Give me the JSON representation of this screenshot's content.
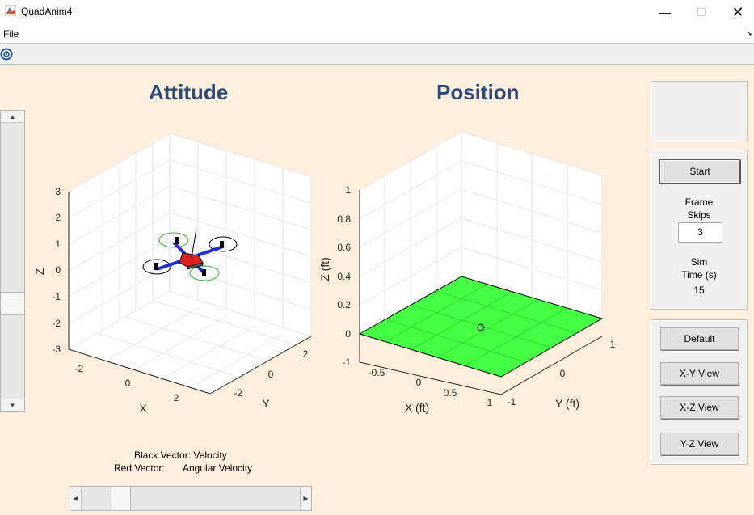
{
  "window": {
    "title": "QuadAnim4",
    "minimize_glyph": "—",
    "maximize_glyph": "☐",
    "close_glyph": "✕"
  },
  "menu": {
    "file_label": "File"
  },
  "toolbar": {
    "icon": "restore-view-icon"
  },
  "colors": {
    "figure_background": "#fdefdc",
    "title_color": "#2e4a7a",
    "ground_plane": "#44ff44",
    "arm_color": "#1f2fd8",
    "body_color": "#dd2020",
    "rotor_green": "#22bb22"
  },
  "attitude_plot": {
    "title": "Attitude",
    "xlabel": "X",
    "ylabel": "Y",
    "zlabel": "Z",
    "z_ticks": [
      "3",
      "2",
      "1",
      "0",
      "-1",
      "-2",
      "-3"
    ],
    "x_ticks": [
      "-2",
      "0",
      "2"
    ],
    "y_ticks": [
      "2",
      "0",
      "-2"
    ]
  },
  "position_plot": {
    "title": "Position",
    "xlabel": "X (ft)",
    "ylabel": "Y (ft)",
    "zlabel": "Z (ft)",
    "z_ticks": [
      "1",
      "0.8",
      "0.6",
      "0.4",
      "0.2",
      "0",
      "-1"
    ],
    "x_ticks": [
      "-0.5",
      "0",
      "0.5",
      "1"
    ],
    "y_ticks": [
      "1",
      "0",
      "-1"
    ]
  },
  "legend": {
    "line1": "Black Vector: Velocity",
    "line2_label": "Red Vector:",
    "line2_value": "Angular Velocity"
  },
  "controls": {
    "start_label": "Start",
    "frame_skips_label_1": "Frame",
    "frame_skips_label_2": "Skips",
    "frame_skips_value": "3",
    "sim_time_label_1": "Sim",
    "sim_time_label_2": "Time (s)",
    "sim_time_value": "15"
  },
  "views": {
    "default_label": "Default",
    "xy_label": "X-Y View",
    "xz_label": "X-Z View",
    "yz_label": "Y-Z View"
  },
  "time_slider": {
    "position_fraction": 0.15
  },
  "side_slider": {
    "position_fraction": 0.67
  }
}
